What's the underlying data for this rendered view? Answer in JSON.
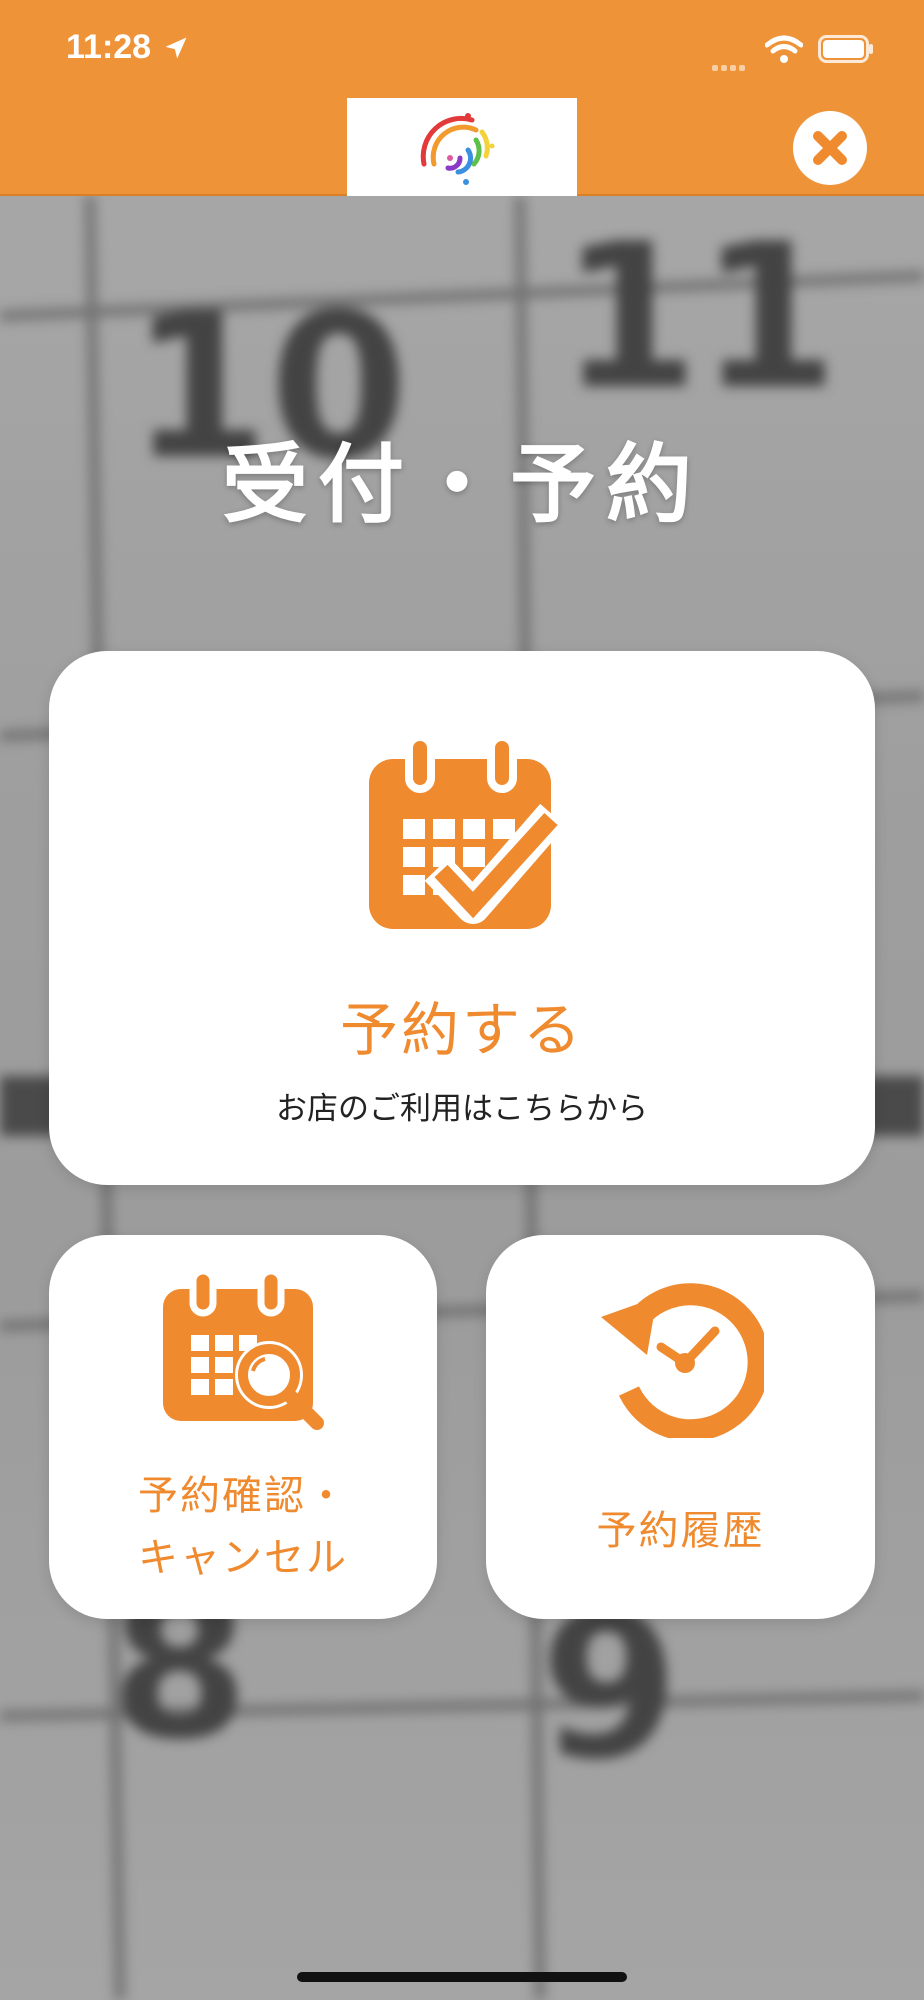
{
  "status_bar": {
    "time": "11:28"
  },
  "header": {
    "accent_color": "#ef9338",
    "logo_icon": "rainbow-logo-icon",
    "close_icon": "close-icon"
  },
  "page": {
    "title": "受付・予約"
  },
  "cards": {
    "reserve": {
      "label": "予約する",
      "sub_label": "お店のご利用はこちらから",
      "icon": "calendar-check-icon"
    },
    "confirm_cancel": {
      "label_line1": "予約確認・",
      "label_line2": "キャンセル",
      "icon": "calendar-search-icon"
    },
    "history": {
      "label": "予約履歴",
      "icon": "history-clock-icon"
    }
  },
  "background": {
    "day_numbers": [
      "10",
      "11",
      "8",
      "9"
    ]
  }
}
